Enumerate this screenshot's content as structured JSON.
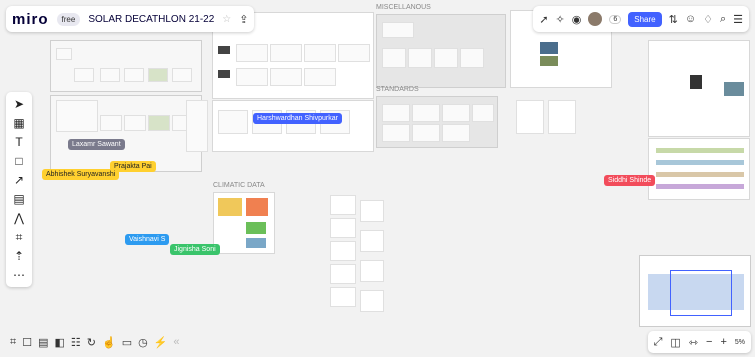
{
  "app": {
    "logo": "miro",
    "plan_badge": "free",
    "board_title": "SOLAR DECATHLON 21-22"
  },
  "topbar": {
    "share_label": "Share",
    "collaborator_count": "6"
  },
  "frames": {
    "miscellanous": "MISCELLANOUS",
    "standards": "STANDARDS",
    "climatic_data": "CLIMATIC DATA"
  },
  "collaborators": [
    {
      "name": "Laxamr Sawant",
      "color": "#7a7a8c"
    },
    {
      "name": "Prajakta Pai",
      "color": "#ffd02f"
    },
    {
      "name": "Abhishek Suryavanshi",
      "color": "#ffd02f"
    },
    {
      "name": "Harshwardhan Shivpurkar",
      "color": "#4262ff"
    },
    {
      "name": "Vaishnavi S",
      "color": "#2d9bf0"
    },
    {
      "name": "Jignisha Soni",
      "color": "#3ac46b"
    },
    {
      "name": "Siddhi Shinde",
      "color": "#f24c5b"
    }
  ],
  "zoom": {
    "level": "5%"
  }
}
